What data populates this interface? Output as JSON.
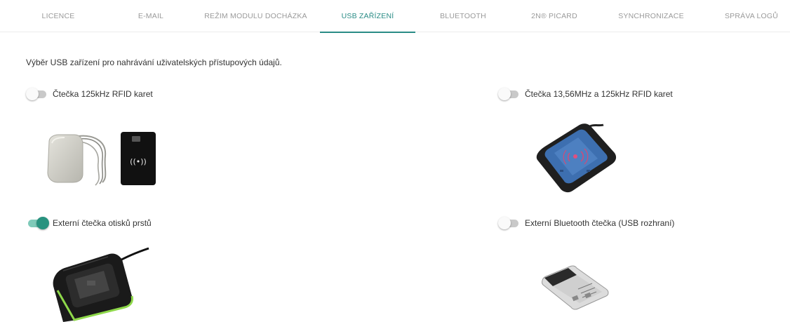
{
  "tabs": [
    {
      "label": "LICENCE",
      "active": false
    },
    {
      "label": "E-MAIL",
      "active": false
    },
    {
      "label": "REŽIM MODULU DOCHÁZKA",
      "active": false
    },
    {
      "label": "USB ZAŘÍZENÍ",
      "active": true
    },
    {
      "label": "BLUETOOTH",
      "active": false
    },
    {
      "label": "2N® PICARD",
      "active": false
    },
    {
      "label": "SYNCHRONIZACE",
      "active": false
    },
    {
      "label": "SPRÁVA LOGŮ",
      "active": false
    }
  ],
  "intro": "Výběr USB zařízení pro nahrávání uživatelských přístupových údajů.",
  "devices": [
    {
      "label": "Čtečka 125kHz RFID karet",
      "enabled": false
    },
    {
      "label": "Čtečka 13,56MHz a 125kHz RFID karet",
      "enabled": false
    },
    {
      "label": "Externí čtečka otisků prstů",
      "enabled": true
    },
    {
      "label": "Externí Bluetooth čtečka (USB rozhraní)",
      "enabled": false
    }
  ],
  "colors": {
    "accent": "#2a8c86",
    "toggle_on": "#28927f",
    "toggle_off": "#c9c9c9"
  },
  "icons": [
    "rfid-wave-icon"
  ],
  "reader_face_text": "((•))"
}
